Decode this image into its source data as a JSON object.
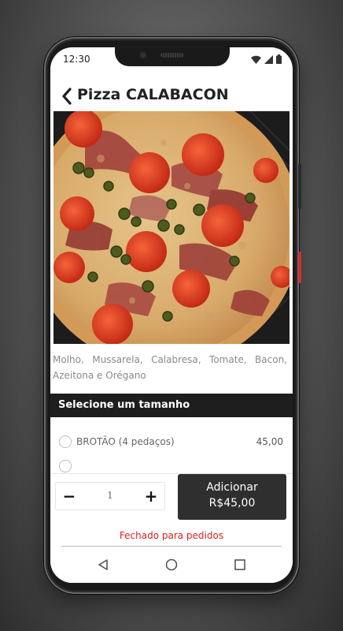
{
  "status": {
    "time": "12:30"
  },
  "header": {
    "title": "Pizza CALABACON"
  },
  "product": {
    "description": "Molho, Mussarela, Calabresa, Tomate, Bacon, Azeitona e Orégano"
  },
  "size_section": {
    "title": "Selecione um tamanho",
    "options": [
      {
        "label": "BROTÃO (4 pedaços)",
        "price": "45,00"
      },
      {
        "label": "",
        "price": ""
      }
    ]
  },
  "order": {
    "quantity": "1",
    "minus": "−",
    "plus": "+",
    "add_label": "Adicionar",
    "add_price": "R$45,00",
    "closed_notice": "Fechado para pedidos"
  },
  "icons": {
    "back": "chevron-left-icon",
    "wifi": "wifi-icon",
    "signal": "signal-icon",
    "battery": "battery-icon",
    "nav_back": "triangle-back-icon",
    "nav_home": "circle-home-icon",
    "nav_recents": "square-recents-icon"
  },
  "colors": {
    "section_bar": "#1e1e1e",
    "add_button": "#2f2f2f",
    "closed_notice": "#e01f1f",
    "power_button": "#d22f2f"
  }
}
